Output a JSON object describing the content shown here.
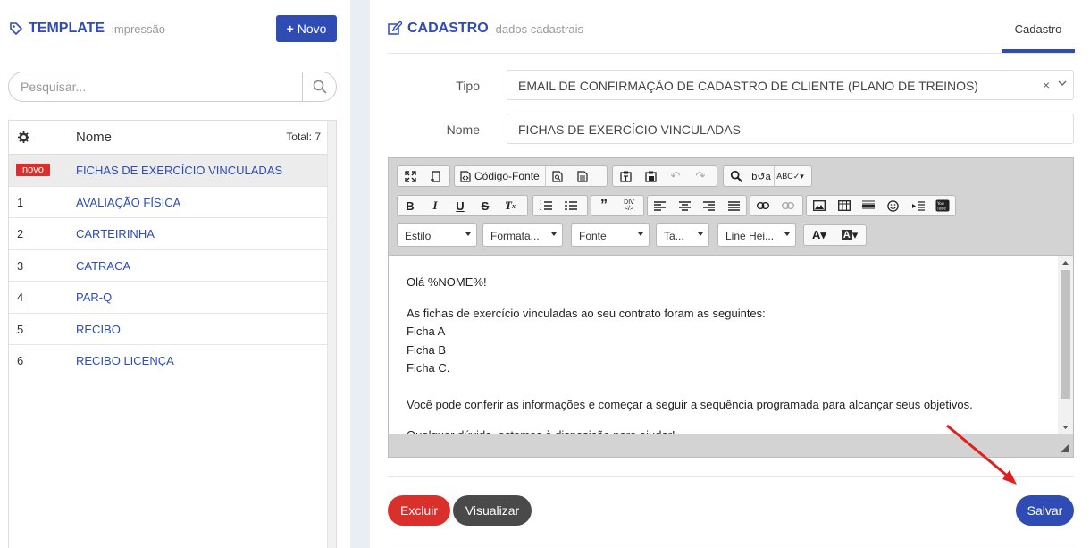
{
  "left": {
    "title": "TEMPLATE",
    "subtitle": "impressão",
    "new_button": "Novo",
    "search_placeholder": "Pesquisar...",
    "list_header": {
      "name": "Nome",
      "total": "Total: 7"
    },
    "rows": [
      {
        "id": "novo",
        "name": "FICHAS DE EXERCÍCIO VINCULADAS",
        "selected": true
      },
      {
        "id": "1",
        "name": "AVALIAÇÃO FÍSICA"
      },
      {
        "id": "2",
        "name": "CARTEIRINHA"
      },
      {
        "id": "3",
        "name": "CATRACA"
      },
      {
        "id": "4",
        "name": "PAR-Q"
      },
      {
        "id": "5",
        "name": "RECIBO"
      },
      {
        "id": "6",
        "name": "RECIBO LICENÇA"
      }
    ]
  },
  "right": {
    "title": "CADASTRO",
    "subtitle": "dados cadastrais",
    "tab": "Cadastro",
    "tipo_label": "Tipo",
    "tipo_value": "EMAIL DE CONFIRMAÇÃO DE CADASTRO DE CLIENTE (PLANO DE TREINOS)",
    "nome_label": "Nome",
    "nome_value": "FICHAS DE EXERCÍCIO VINCULADAS",
    "toolbar": {
      "source": "Código-Fonte",
      "estilo": "Estilo",
      "formato": "Formata...",
      "fonte": "Fonte",
      "tamanho": "Ta...",
      "line_height": "Line Hei..."
    },
    "content": {
      "greeting": "Olá %NOME%!",
      "line1": "As fichas de exercício vinculadas ao seu contrato foram as seguintes:",
      "line2": "Ficha A",
      "line3": "Ficha B",
      "line4": "Ficha C.",
      "line5": "Você pode conferir as informações e começar a seguir a sequência programada para alcançar seus objetivos.",
      "line6": "Qualquer dúvida, estamos à disposição para ajudar!"
    },
    "buttons": {
      "delete": "Excluir",
      "preview": "Visualizar",
      "save": "Salvar"
    }
  },
  "colors": {
    "primary": "#2e4cb3",
    "danger": "#d9302c",
    "dark": "#4a4a4a"
  }
}
